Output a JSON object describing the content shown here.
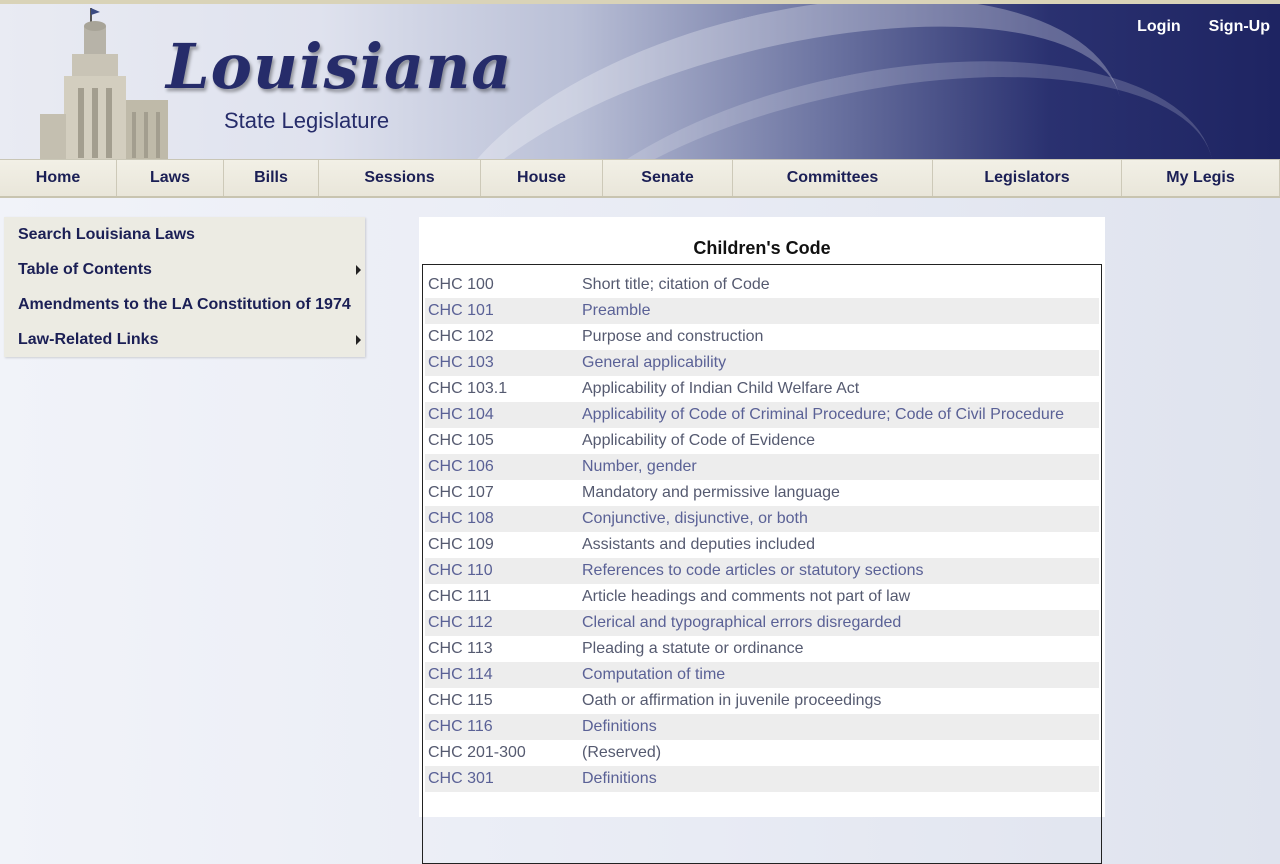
{
  "header": {
    "logo_main": "Louisiana",
    "logo_sub": "State Legislature",
    "login_label": "Login",
    "signup_label": "Sign-Up"
  },
  "nav": [
    {
      "label": "Home"
    },
    {
      "label": "Laws"
    },
    {
      "label": "Bills"
    },
    {
      "label": "Sessions"
    },
    {
      "label": "House"
    },
    {
      "label": "Senate"
    },
    {
      "label": "Committees"
    },
    {
      "label": "Legislators"
    },
    {
      "label": "My Legis"
    }
  ],
  "sidebar": {
    "items": [
      {
        "label": "Search Louisiana Laws",
        "has_submenu": false
      },
      {
        "label": "Table of Contents",
        "has_submenu": true
      },
      {
        "label": "Amendments to the LA Constitution of 1974",
        "has_submenu": false
      },
      {
        "label": "Law-Related Links",
        "has_submenu": true
      }
    ]
  },
  "main": {
    "title": "Children's Code",
    "rows": [
      {
        "code": "CHC 100",
        "title": "Short title; citation of Code",
        "style": "plain"
      },
      {
        "code": "CHC 101",
        "title": "Preamble",
        "style": "link"
      },
      {
        "code": "CHC 102",
        "title": "Purpose and construction",
        "style": "plain"
      },
      {
        "code": "CHC 103",
        "title": "General applicability",
        "style": "link"
      },
      {
        "code": "CHC 103.1",
        "title": "Applicability of Indian Child Welfare Act",
        "style": "plain"
      },
      {
        "code": "CHC 104",
        "title": "Applicability of Code of Criminal Procedure; Code of Civil Procedure",
        "style": "link"
      },
      {
        "code": "CHC 105",
        "title": "Applicability of Code of Evidence",
        "style": "plain"
      },
      {
        "code": "CHC 106",
        "title": "Number, gender",
        "style": "link"
      },
      {
        "code": "CHC 107",
        "title": "Mandatory and permissive language",
        "style": "plain"
      },
      {
        "code": "CHC 108",
        "title": "Conjunctive, disjunctive, or both",
        "style": "link"
      },
      {
        "code": "CHC 109",
        "title": "Assistants and deputies included",
        "style": "plain"
      },
      {
        "code": "CHC 110",
        "title": "References to code articles or statutory sections",
        "style": "link"
      },
      {
        "code": "CHC 111",
        "title": "Article headings and comments not part of law",
        "style": "plain"
      },
      {
        "code": "CHC 112",
        "title": "Clerical and typographical errors disregarded",
        "style": "link"
      },
      {
        "code": "CHC 113",
        "title": "Pleading a statute or ordinance",
        "style": "plain"
      },
      {
        "code": "CHC 114",
        "title": "Computation of time",
        "style": "link"
      },
      {
        "code": "CHC 115",
        "title": "Oath or affirmation in juvenile proceedings",
        "style": "plain"
      },
      {
        "code": "CHC 116",
        "title": "Definitions",
        "style": "link"
      },
      {
        "code": "CHC 201-300",
        "title": "(Reserved)",
        "style": "plain"
      },
      {
        "code": "CHC 301",
        "title": "Definitions",
        "style": "link"
      }
    ]
  }
}
